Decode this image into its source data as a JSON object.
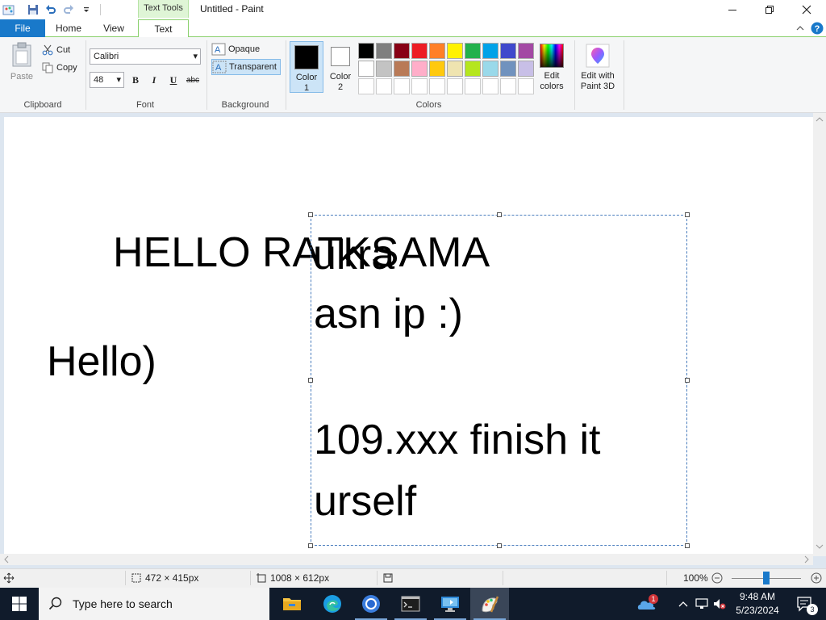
{
  "window": {
    "title": "Untitled - Paint",
    "context_tab": "Text Tools"
  },
  "tabs": {
    "file": "File",
    "home": "Home",
    "view": "View",
    "text": "Text"
  },
  "ribbon": {
    "clipboard": {
      "label": "Clipboard",
      "paste": "Paste",
      "cut": "Cut",
      "copy": "Copy"
    },
    "font": {
      "label": "Font",
      "family": "Calibri",
      "size": "48",
      "bold": "B",
      "italic": "I",
      "underline": "U",
      "strike": "abc"
    },
    "background": {
      "label": "Background",
      "opaque": "Opaque",
      "transparent": "Transparent",
      "selected": "Transparent"
    },
    "colors": {
      "label": "Colors",
      "color1_label_a": "Color",
      "color1_label_b": "1",
      "color2_label_a": "Color",
      "color2_label_b": "2",
      "color1": "#000000",
      "color2": "#ffffff",
      "edit_colors_a": "Edit",
      "edit_colors_b": "colors",
      "palette_row1": [
        "#000000",
        "#7f7f7f",
        "#880015",
        "#ed1c24",
        "#ff7f27",
        "#fff200",
        "#22b14c",
        "#00a2e8",
        "#3f48cc",
        "#a349a4"
      ],
      "palette_row2": [
        "#ffffff",
        "#c3c3c3",
        "#b97a57",
        "#ffaec9",
        "#ffc90e",
        "#efe4b0",
        "#b5e61d",
        "#99d9ea",
        "#7092be",
        "#c8bfe7"
      ],
      "palette_row3": [
        "#ffffff",
        "#ffffff",
        "#ffffff",
        "#ffffff",
        "#ffffff",
        "#ffffff",
        "#ffffff",
        "#ffffff",
        "#ffffff",
        "#ffffff"
      ]
    },
    "paint3d": {
      "label_a": "Edit with",
      "label_b": "Paint 3D"
    }
  },
  "canvas": {
    "text_hello_ratksama": "HELLO RATKSAMA",
    "text_ukra": "ukra",
    "text_hello_paren": "Hello)",
    "textbox_line1": "asn ip :)",
    "textbox_line2": "109.xxx finish it",
    "textbox_line3": "urself"
  },
  "statusbar": {
    "selection_size": "472 × 415px",
    "image_size": "1008 × 612px",
    "zoom": "100%"
  },
  "taskbar": {
    "search_placeholder": "Type here to search",
    "time": "9:48 AM",
    "date": "5/23/2024",
    "weather_badge": "1",
    "notification_count": "3"
  }
}
